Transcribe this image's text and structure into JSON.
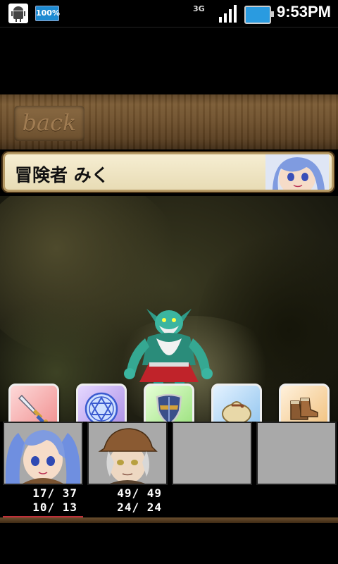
{
  "status_bar": {
    "battery_small_label": "100%",
    "network": "3G",
    "time": "9:53PM"
  },
  "header": {
    "back_label": "back"
  },
  "banner": {
    "text": "冒険者 みく"
  },
  "commands": [
    {
      "id": "attack",
      "icon": "sword-icon"
    },
    {
      "id": "magic",
      "icon": "hexagram-icon"
    },
    {
      "id": "defend",
      "icon": "shield-icon"
    },
    {
      "id": "item",
      "icon": "bag-icon"
    },
    {
      "id": "run",
      "icon": "boots-icon"
    }
  ],
  "party": [
    {
      "hp": "17/ 37",
      "mp": "10/ 13"
    },
    {
      "hp": "49/ 49",
      "mp": "24/ 24"
    }
  ],
  "colors": {
    "wood": "#6c4e2b",
    "banner_bg": "#f6eed2",
    "hp_underline": "#c0303a"
  }
}
